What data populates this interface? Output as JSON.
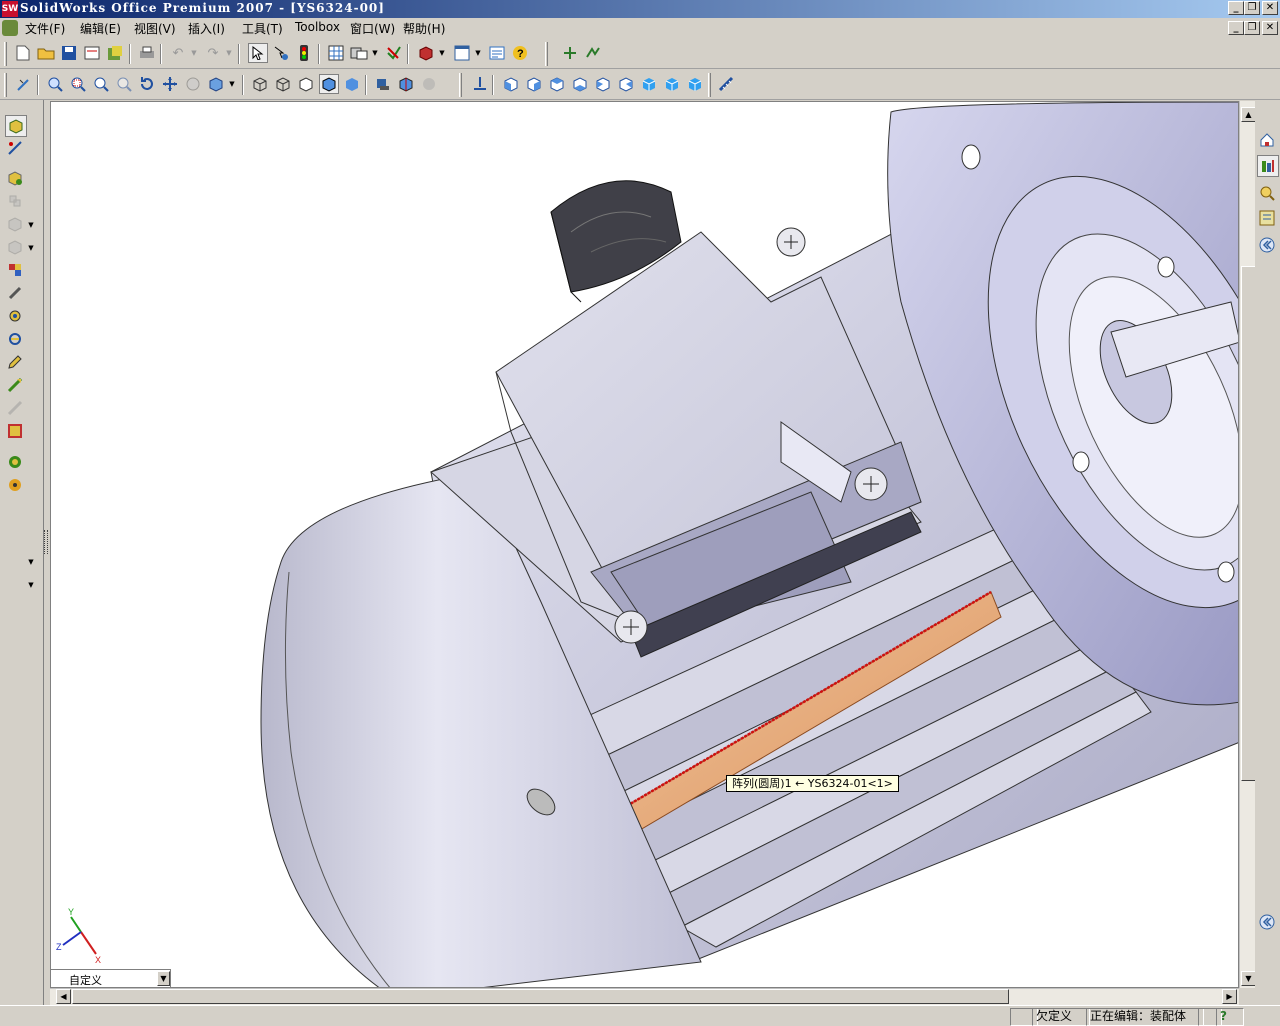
{
  "window": {
    "title": "SolidWorks Office Premium 2007 - [YS6324-00]",
    "app_icon_text": "SW",
    "min_glyph": "_",
    "restore_glyph": "❐",
    "close_glyph": "✕"
  },
  "menu": {
    "items": [
      {
        "label": "文件(F)"
      },
      {
        "label": "编辑(E)"
      },
      {
        "label": "视图(V)"
      },
      {
        "label": "插入(I)"
      },
      {
        "label": "工具(T)"
      },
      {
        "label": "Toolbox"
      },
      {
        "label": "窗口(W)"
      },
      {
        "label": "帮助(H)"
      }
    ]
  },
  "toolbar_standard": {
    "icons": [
      "new-document-icon",
      "open-folder-icon",
      "save-icon",
      "print-preview-icon",
      "make-drawing-icon",
      "print-icon",
      "undo-icon",
      "redo-icon",
      "select-icon",
      "smart-dimension-icon",
      "traffic-light-icon",
      "grid-icon",
      "options-icon",
      "rebuild-icon",
      "3d-box-icon",
      "window-icon",
      "properties-icon",
      "help-icon",
      "macro-icon",
      "macro-record-icon"
    ]
  },
  "toolbar_view": {
    "icons": [
      "sketch-icon",
      "zoom-to-fit-icon",
      "zoom-area-icon",
      "zoom-in-out-icon",
      "zoom-selection-icon",
      "rotate-icon",
      "pan-icon",
      "roll-view-icon",
      "view-orientation-icon",
      "wireframe-icon",
      "hidden-lines-visible-icon",
      "hidden-lines-removed-icon",
      "shaded-with-edges-icon",
      "shaded-icon",
      "shadows-icon",
      "section-view-icon",
      "realview-icon",
      "normal-to-icon",
      "front-view-icon",
      "back-view-icon",
      "left-view-icon",
      "right-view-icon",
      "top-view-icon",
      "bottom-view-icon",
      "isometric-view-icon",
      "trimetric-view-icon",
      "dimetric-view-icon",
      "measure-icon"
    ]
  },
  "left_toolbar": {
    "icons": [
      "assembly-icon",
      "sketch-dim-icon",
      "insert-component-icon",
      "mate-icon",
      "move-component-icon",
      "rotate-component-icon",
      "explode-icon",
      "exploded-line-icon",
      "interference-icon",
      "hide-show-icon",
      "edit-component-icon",
      "smart-fastener-icon",
      "new-part-icon",
      "assembly-features-icon",
      "simulation-icon"
    ]
  },
  "task_pane": {
    "icons": [
      "home-icon",
      "design-library-icon",
      "file-explorer-icon",
      "view-palette-icon",
      "collapse-icon"
    ],
    "bottom_icon": "expand-icon"
  },
  "viewport": {
    "background": "#ffffff",
    "model": "YS6324-00",
    "tooltip": "阵列(圆周)1 ← YS6324-01<1>",
    "highlight_color": "#e8a070",
    "selection_edge_color": "#d01010",
    "triad": {
      "x": "X",
      "y": "Y",
      "z": "Z"
    }
  },
  "view_combo": {
    "value": "自定义",
    "arrow": "▼"
  },
  "scrollbars": {
    "up": "▲",
    "down": "▼",
    "left": "◀",
    "right": "▶"
  },
  "status": {
    "underdefined": "欠定义",
    "editing": "正在编辑：装配体",
    "help_icon": "?"
  }
}
